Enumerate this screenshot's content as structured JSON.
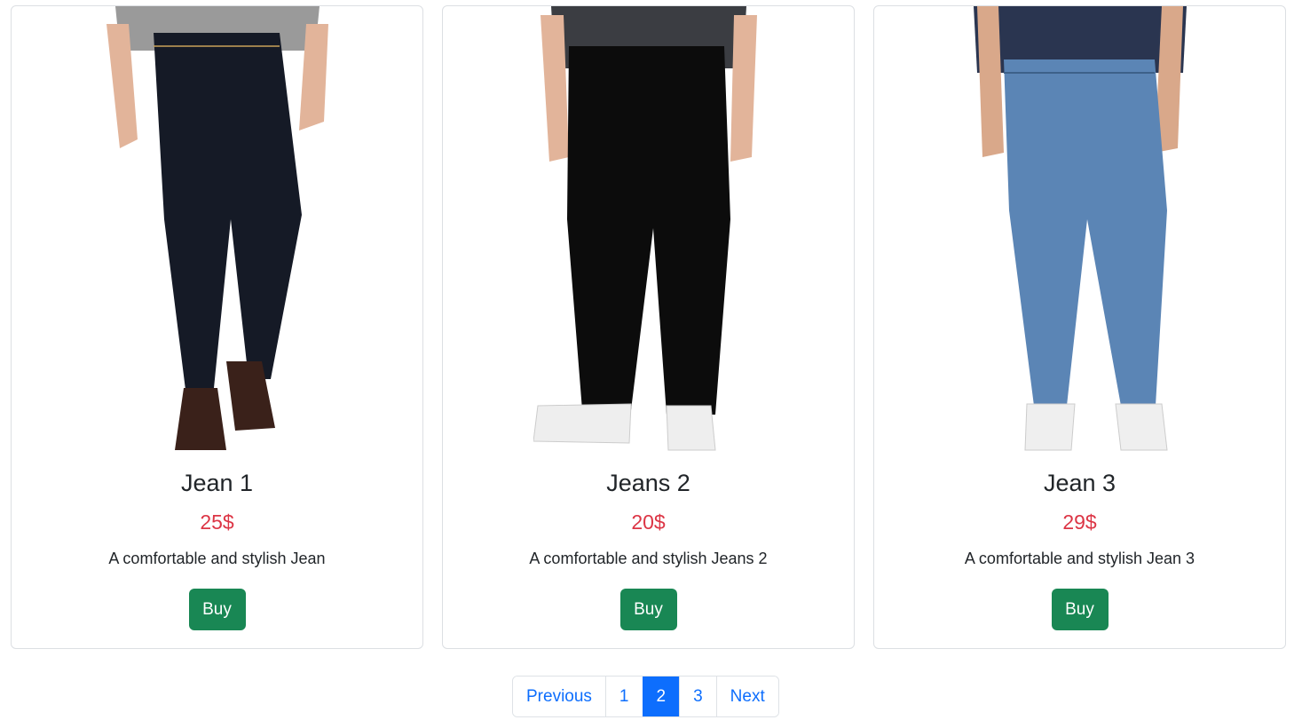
{
  "colors": {
    "price": "#dc3545",
    "buy_button": "#198754",
    "pagination_link": "#0d6efd",
    "pagination_active": "#0d6efd"
  },
  "products": [
    {
      "title": "Jean 1",
      "price": "25$",
      "description": "A comfortable and stylish Jean",
      "buy_label": "Buy",
      "image": "dark-indigo-jeans-with-boots"
    },
    {
      "title": "Jeans 2",
      "price": "20$",
      "description": "A comfortable and stylish Jeans 2",
      "buy_label": "Buy",
      "image": "black-jeans-with-white-sneakers"
    },
    {
      "title": "Jean 3",
      "price": "29$",
      "description": "A comfortable and stylish Jean 3",
      "buy_label": "Buy",
      "image": "light-blue-jeans-with-white-sneakers"
    }
  ],
  "pagination": {
    "previous_label": "Previous",
    "pages": [
      "1",
      "2",
      "3"
    ],
    "active_page": "2",
    "next_label": "Next"
  }
}
